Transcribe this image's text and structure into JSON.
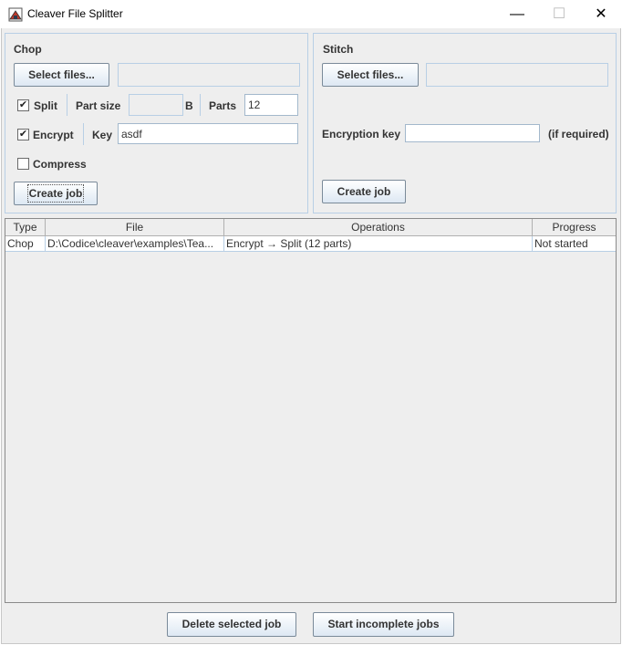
{
  "window": {
    "title": "Cleaver File Splitter",
    "icon": "cleaver-app-icon",
    "controls": {
      "minimize": "—",
      "maximize": "☐",
      "close": "✕"
    }
  },
  "chop": {
    "title": "Chop",
    "select_files_label": "Select files...",
    "selected_files_value": "",
    "split_checked": true,
    "split_label": "Split",
    "part_size_label": "Part size",
    "part_size_value": "",
    "part_size_unit": "B",
    "parts_label": "Parts",
    "parts_value": "12",
    "encrypt_checked": true,
    "encrypt_label": "Encrypt",
    "key_label": "Key",
    "key_value": "asdf",
    "compress_checked": false,
    "compress_label": "Compress",
    "create_job_label": "Create job"
  },
  "stitch": {
    "title": "Stitch",
    "select_files_label": "Select files...",
    "selected_files_value": "",
    "encryption_key_label": "Encryption key",
    "encryption_key_value": "",
    "if_required_label": "(if required)",
    "create_job_label": "Create job"
  },
  "jobs_table": {
    "columns": [
      "Type",
      "File",
      "Operations",
      "Progress"
    ],
    "rows": [
      {
        "type": "Chop",
        "file": "D:\\Codice\\cleaver\\examples\\Tea...",
        "operations": "Encrypt → Split (12 parts)",
        "progress": "Not started"
      }
    ]
  },
  "footer": {
    "delete_selected_label": "Delete selected job",
    "start_incomplete_label": "Start incomplete jobs"
  },
  "colors": {
    "accent_border": "#b8cfe5",
    "panel_bg": "#eeeeee",
    "button_gradient_top": "#ffffff",
    "button_gradient_bottom": "#dde8f3"
  }
}
